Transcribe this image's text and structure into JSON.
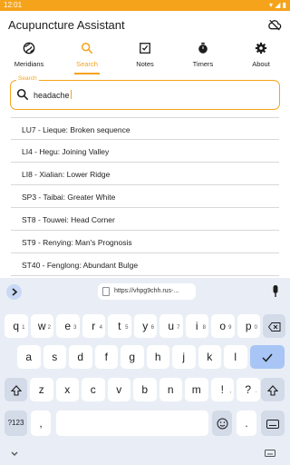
{
  "status": {
    "time": "12:01"
  },
  "app": {
    "title": "Acupuncture Assistant",
    "cloud_icon": "cloud-sync-icon",
    "accent": "#f5a31a"
  },
  "tabs": [
    {
      "label": "Meridians",
      "icon": "meridians-icon"
    },
    {
      "label": "Search",
      "icon": "search-icon",
      "active": true
    },
    {
      "label": "Notes",
      "icon": "notes-icon"
    },
    {
      "label": "Timers",
      "icon": "timer-icon"
    },
    {
      "label": "About",
      "icon": "gear-icon"
    }
  ],
  "search": {
    "legend": "Search",
    "value": "headache"
  },
  "results": [
    "LU7 - Lieque: Broken sequence",
    "LI4 - Hegu: Joining Valley",
    "LI8 - Xialian: Lower Ridge",
    "SP3 - Taibai: Greater White",
    "ST8 - Touwei: Head Corner",
    "ST9 - Renying: Man's Prognosis",
    "ST40 - Fenglong: Abundant Bulge"
  ],
  "keyboard": {
    "url_chip": "https://vhpg9chh.rus-...",
    "row1": [
      "q",
      "w",
      "e",
      "r",
      "t",
      "y",
      "u",
      "i",
      "o",
      "p"
    ],
    "row1_hints": [
      "1",
      "2",
      "3",
      "4",
      "5",
      "6",
      "7",
      "8",
      "9",
      "0"
    ],
    "row2": [
      "a",
      "s",
      "d",
      "f",
      "g",
      "h",
      "j",
      "k",
      "l"
    ],
    "row3": [
      "z",
      "x",
      "c",
      "v",
      "b",
      "n",
      "m",
      "!",
      "?"
    ],
    "row3_hints": [
      "",
      "",
      "",
      "",
      "",
      "",
      "",
      ",",
      "."
    ],
    "symbols_label": "?123",
    "comma": ",",
    "period": ".",
    "emoji_icon": "emoji-icon"
  }
}
